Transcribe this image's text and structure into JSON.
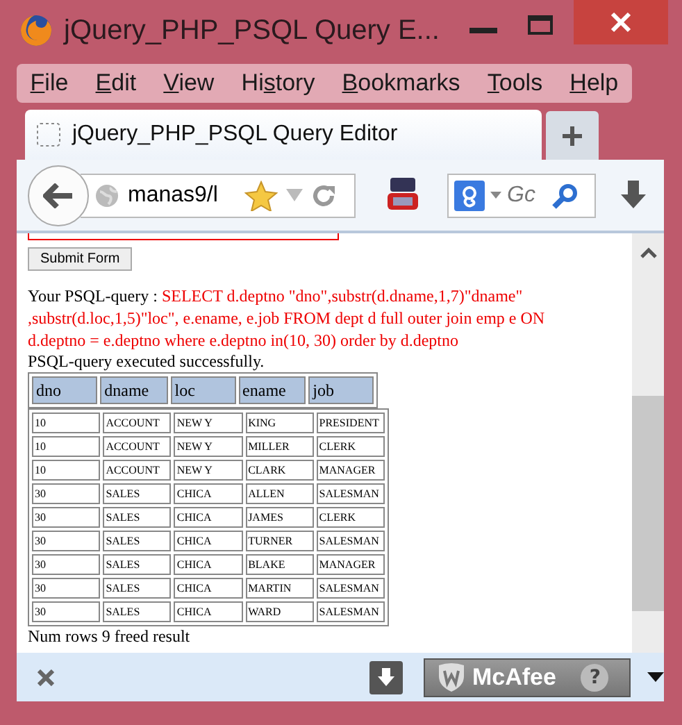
{
  "window": {
    "title": "jQuery_PHP_PSQL Query E..."
  },
  "menu": [
    {
      "key": "F",
      "post": "ile"
    },
    {
      "key": "E",
      "post": "dit"
    },
    {
      "key": "V",
      "post": "iew"
    },
    {
      "pre": "Hi",
      "key": "s",
      "post": "tory"
    },
    {
      "key": "B",
      "post": "ookmarks"
    },
    {
      "key": "T",
      "post": "ools"
    },
    {
      "key": "H",
      "post": "elp"
    }
  ],
  "tabs": [
    {
      "label": "jQuery_PHP_PSQL Query Editor",
      "selected": true
    }
  ],
  "nav": {
    "url": "manas9/l",
    "search_placeholder": "Gc"
  },
  "page": {
    "submit": "Submit Form",
    "query_label": "Your PSQL-query :",
    "query": "SELECT d.deptno \"dno\",substr(d.dname,1,7)\"dname\" ,substr(d.loc,1,5)\"loc\", e.ename, e.job FROM dept d full outer join emp e ON d.deptno = e.deptno where e.deptno in(10, 30) order by d.deptno",
    "status": "PSQL-query executed successfully.",
    "table": {
      "columns": [
        "dno",
        "dname",
        "loc",
        "ename",
        "job"
      ],
      "rows": [
        [
          "10",
          "ACCOUNT",
          "NEW Y",
          "KING",
          "PRESIDENT"
        ],
        [
          "10",
          "ACCOUNT",
          "NEW Y",
          "MILLER",
          "CLERK"
        ],
        [
          "10",
          "ACCOUNT",
          "NEW Y",
          "CLARK",
          "MANAGER"
        ],
        [
          "30",
          "SALES",
          "CHICA",
          "ALLEN",
          "SALESMAN"
        ],
        [
          "30",
          "SALES",
          "CHICA",
          "JAMES",
          "CLERK"
        ],
        [
          "30",
          "SALES",
          "CHICA",
          "TURNER",
          "SALESMAN"
        ],
        [
          "30",
          "SALES",
          "CHICA",
          "BLAKE",
          "MANAGER"
        ],
        [
          "30",
          "SALES",
          "CHICA",
          "MARTIN",
          "SALESMAN"
        ],
        [
          "30",
          "SALES",
          "CHICA",
          "WARD",
          "SALESMAN"
        ]
      ]
    },
    "footer": "Num rows 9 freed result"
  },
  "addon_bar": {
    "badge": "McAfee",
    "help": "?"
  }
}
